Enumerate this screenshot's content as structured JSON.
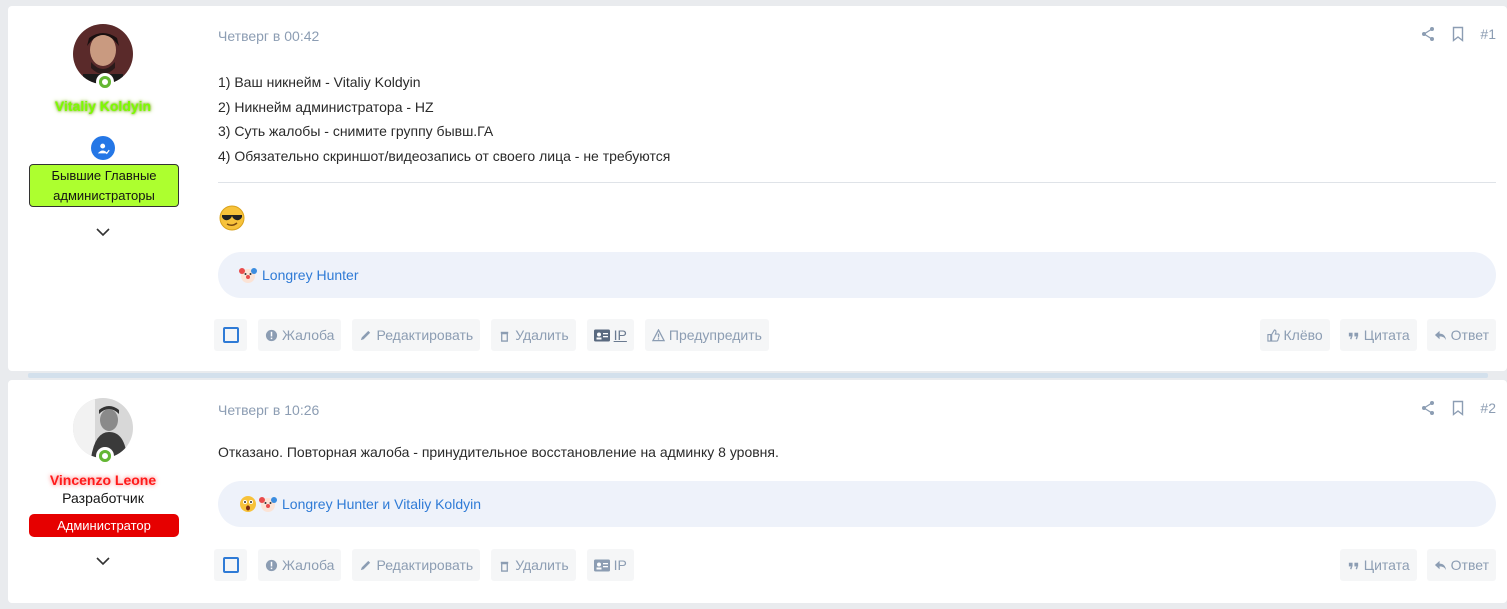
{
  "posts": [
    {
      "user": {
        "name": "Vitaliy Koldyin",
        "banner": "Бывшие Главные администраторы"
      },
      "date": "Четверг в 00:42",
      "number": "#1",
      "lines": [
        "1) Ваш никнейм - Vitaliy Koldyin",
        "2) Никнейм администратора - HZ",
        "3) Суть жалобы - снимите группу бывш.ГА",
        "4) Обязательно скриншот/видеозапись от своего лица - не требуются"
      ],
      "reactions": "Longrey Hunter",
      "actions": {
        "report": "Жалоба",
        "edit": "Редактировать",
        "delete": "Удалить",
        "ip": "IP",
        "warn": "Предупредить",
        "like": "Клёво",
        "quote": "Цитата",
        "reply": "Ответ"
      }
    },
    {
      "user": {
        "name": "Vincenzo Leone",
        "title": "Разработчик",
        "banner": "Администратор"
      },
      "date": "Четверг в 10:26",
      "number": "#2",
      "text": "Отказано. Повторная жалоба - принудительное восстановление на админку 8 уровня.",
      "reactions": "Longrey Hunter и Vitaliy Koldyin",
      "actions": {
        "report": "Жалоба",
        "edit": "Редактировать",
        "delete": "Удалить",
        "ip": "IP",
        "quote": "Цитата",
        "reply": "Ответ"
      }
    }
  ],
  "colors": {
    "accent": "#2f7bd6",
    "muted": "#8c9db3",
    "banner1": "#adff2f",
    "banner2": "#e60000"
  }
}
